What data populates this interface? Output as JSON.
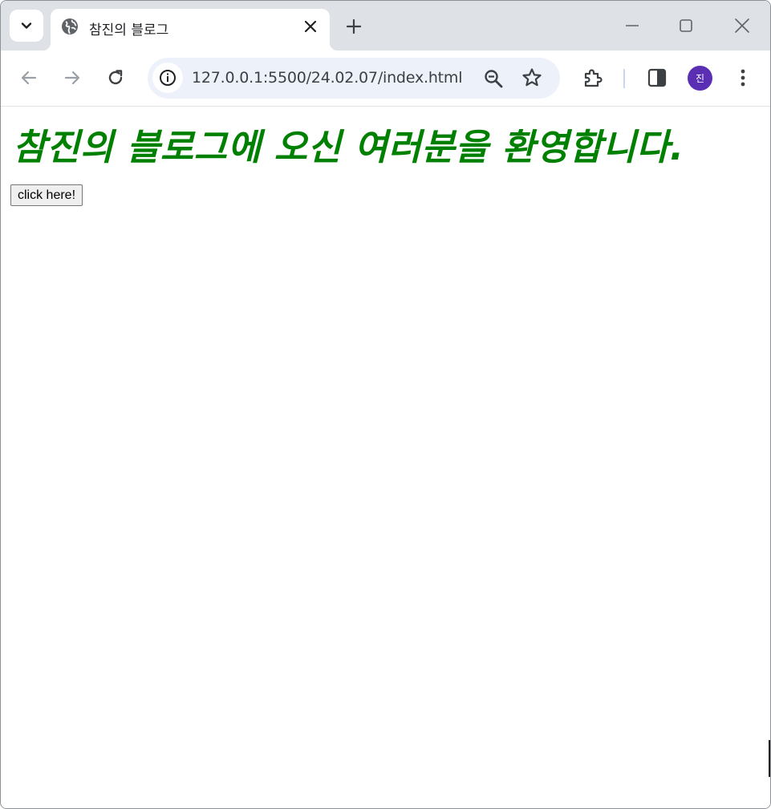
{
  "browser": {
    "tab": {
      "title": "참진의 블로그"
    },
    "address_bar": {
      "url": "127.0.0.1:5500/24.02.07/index.html"
    },
    "profile": {
      "initial": "진",
      "color": "#5b2fb3"
    }
  },
  "page": {
    "heading": "참진의 블로그에 오신 여러분을 환영합니다.",
    "heading_color": "#008000",
    "button_label": "click here!"
  },
  "icons": {
    "tab_search": "chevron-down-icon",
    "favicon": "globe-icon",
    "tab_close": "close-icon",
    "new_tab": "plus-icon",
    "minimize": "minimize-icon",
    "maximize": "maximize-icon",
    "window_close": "close-icon",
    "back": "arrow-left-icon",
    "forward": "arrow-right-icon",
    "reload": "reload-icon",
    "site_info": "info-icon",
    "zoom": "zoom-out-icon",
    "bookmark": "star-icon",
    "extensions": "puzzle-icon",
    "side_panel": "side-panel-icon",
    "menu": "kebab-menu-icon"
  }
}
